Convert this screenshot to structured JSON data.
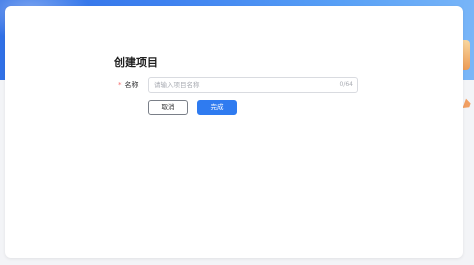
{
  "dialog": {
    "title": "创建项目"
  },
  "form": {
    "name": {
      "required_mark": "*",
      "label": "名称",
      "value": "",
      "placeholder": "请输入项目名称",
      "counter": "0/64"
    }
  },
  "actions": {
    "cancel_label": "取消",
    "done_label": "完成"
  },
  "colors": {
    "primary": "#2f7bf0",
    "banner": "#3f82f0",
    "required": "#f56c6c"
  }
}
